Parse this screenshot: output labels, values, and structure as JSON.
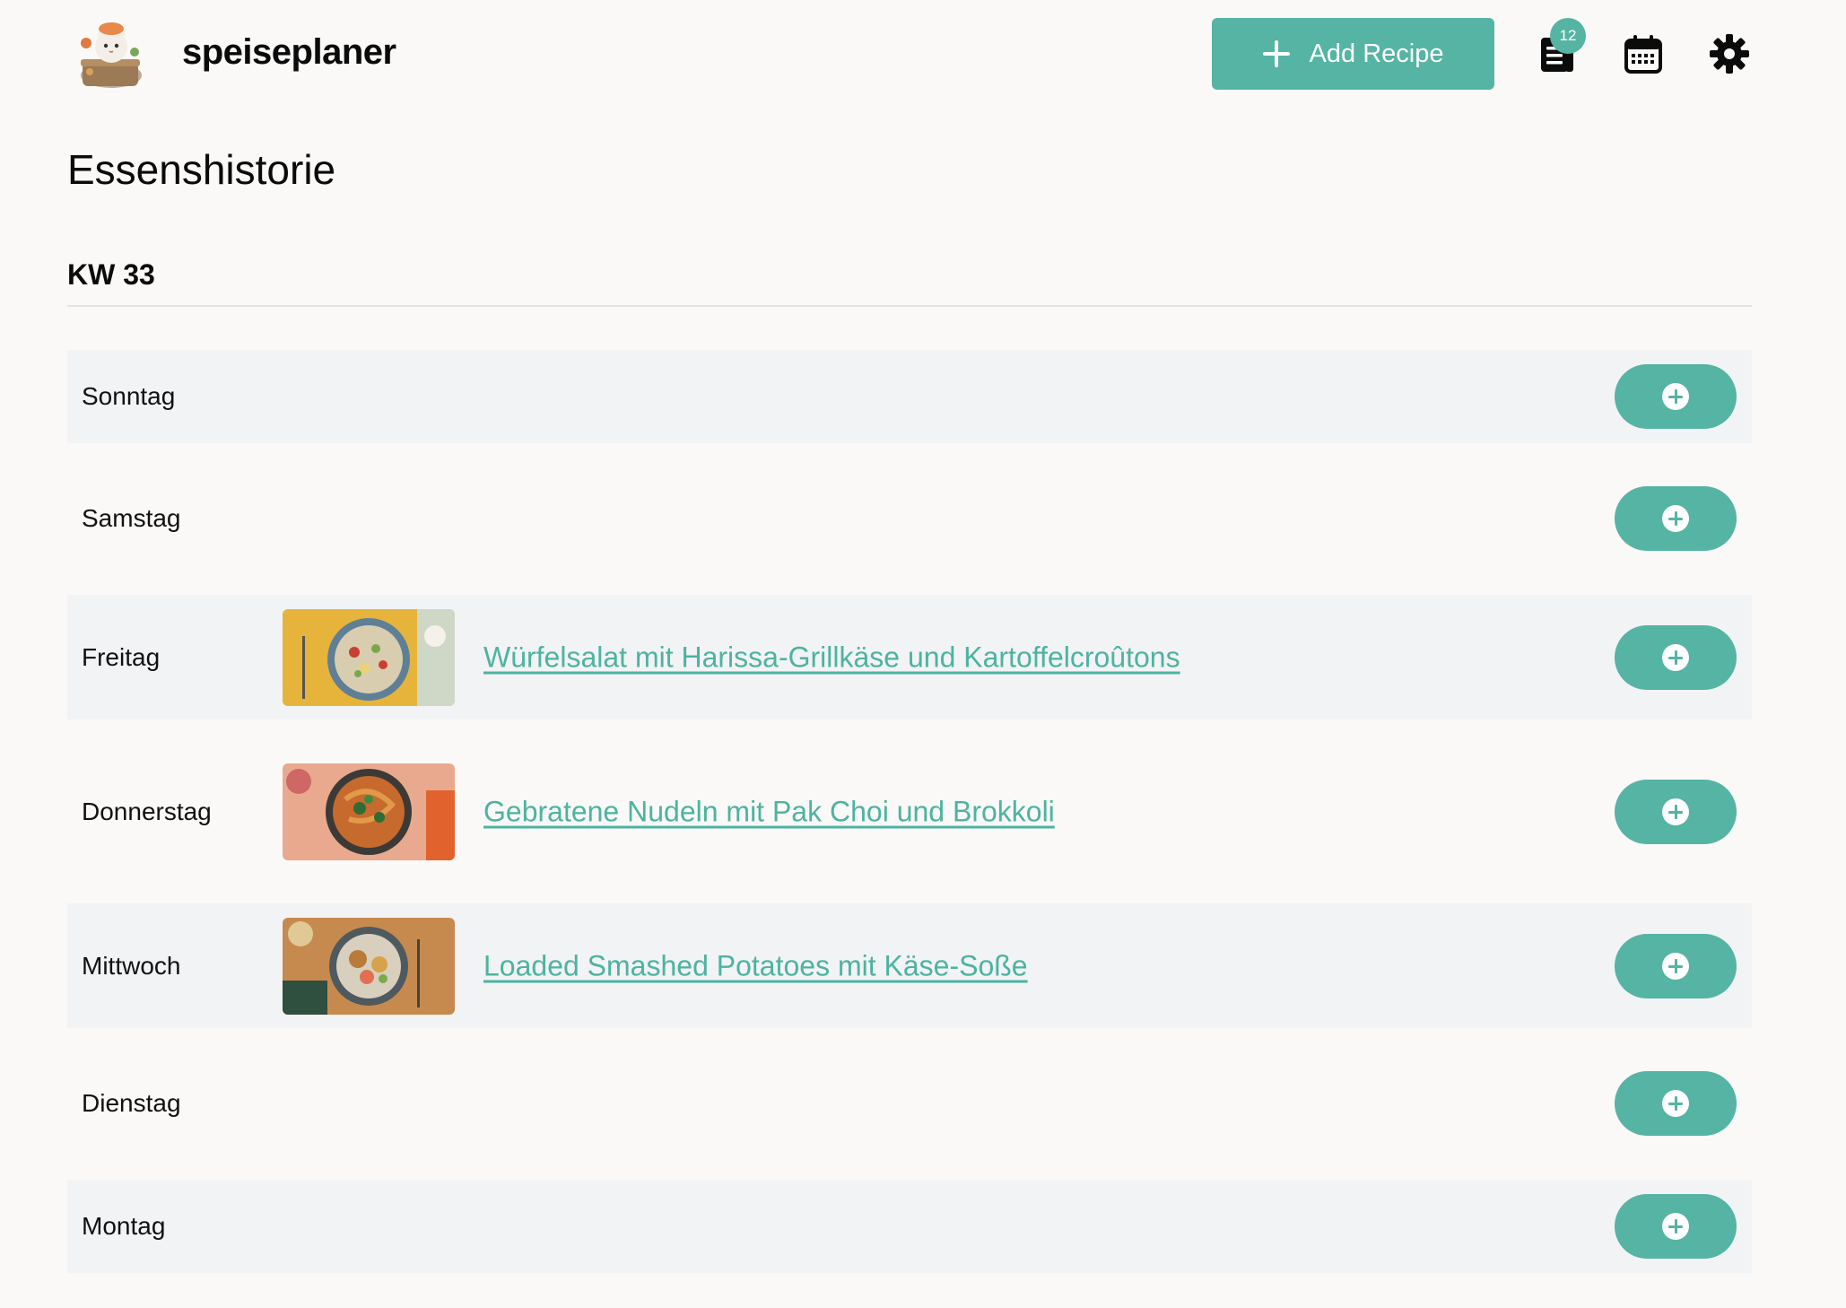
{
  "header": {
    "brand": "speiseplaner",
    "add_recipe_label": "Add Recipe",
    "shopping_list_count": "12",
    "icons": [
      "chef-cat-logo",
      "plus-icon",
      "shopping-list-icon",
      "calendar-icon",
      "gear-icon"
    ]
  },
  "page": {
    "title": "Essenshistorie",
    "week": "KW 33"
  },
  "days": [
    {
      "name": "Sonntag",
      "recipe": ""
    },
    {
      "name": "Samstag",
      "recipe": ""
    },
    {
      "name": "Freitag",
      "recipe": "Würfelsalat mit Harissa-Grillkäse und Kartoffelcroûtons"
    },
    {
      "name": "Donnerstag",
      "recipe": "Gebratene Nudeln mit Pak Choi und Brokkoli"
    },
    {
      "name": "Mittwoch",
      "recipe": "Loaded Smashed Potatoes mit Käse-Soße"
    },
    {
      "name": "Dienstag",
      "recipe": ""
    },
    {
      "name": "Montag",
      "recipe": ""
    }
  ],
  "colors": {
    "accent": "#55b4a3",
    "link": "#4db3a0",
    "row_shade": "#f2f3f5",
    "background": "#faf9f7"
  }
}
